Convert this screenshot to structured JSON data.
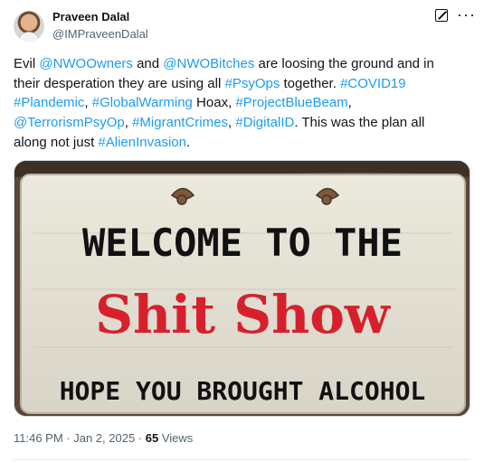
{
  "author": {
    "name": "Praveen Dalal",
    "handle": "@IMPraveenDalal"
  },
  "post": {
    "lines": [
      [
        {
          "text": "Evil ",
          "tag": false
        },
        {
          "text": "@NWOOwners",
          "tag": true
        },
        {
          "text": " and ",
          "tag": false
        },
        {
          "text": "@NWOBitches",
          "tag": true
        },
        {
          "text": " are loosing the ground and in",
          "tag": false
        }
      ],
      [
        {
          "text": "their desperation they are using all ",
          "tag": false
        },
        {
          "text": "#PsyOps",
          "tag": true
        },
        {
          "text": " together. ",
          "tag": false
        },
        {
          "text": "#COVID19",
          "tag": true
        }
      ],
      [
        {
          "text": "#Plandemic",
          "tag": true
        },
        {
          "text": ", ",
          "tag": false
        },
        {
          "text": "#GlobalWarming",
          "tag": true
        },
        {
          "text": " Hoax, ",
          "tag": false
        },
        {
          "text": "#ProjectBlueBeam",
          "tag": true
        },
        {
          "text": ",",
          "tag": false
        }
      ],
      [
        {
          "text": "@TerrorismPsyOp",
          "tag": true
        },
        {
          "text": ", ",
          "tag": false
        },
        {
          "text": "#MigrantCrimes",
          "tag": true
        },
        {
          "text": ", ",
          "tag": false
        },
        {
          "text": "#DigitalID",
          "tag": true
        },
        {
          "text": ". This was the plan all",
          "tag": false
        }
      ],
      [
        {
          "text": "along not just ",
          "tag": false
        },
        {
          "text": "#AlienInvasion",
          "tag": true
        },
        {
          "text": ".",
          "tag": false
        }
      ]
    ]
  },
  "image": {
    "line1": "WELCOME TO THE",
    "line2": "Shit Show",
    "line3": "HOPE YOU BROUGHT ALCOHOL"
  },
  "meta": {
    "datetime": "11:46 PM · Jan 2, 2025 · ",
    "views_count": "65",
    "views_label": " Views"
  },
  "colors": {
    "link": "#1d9bf0",
    "text": "#0f1419",
    "secondary": "#536471",
    "sign_red": "#d6202c"
  },
  "icons": [
    "grok-icon",
    "more-icon"
  ]
}
